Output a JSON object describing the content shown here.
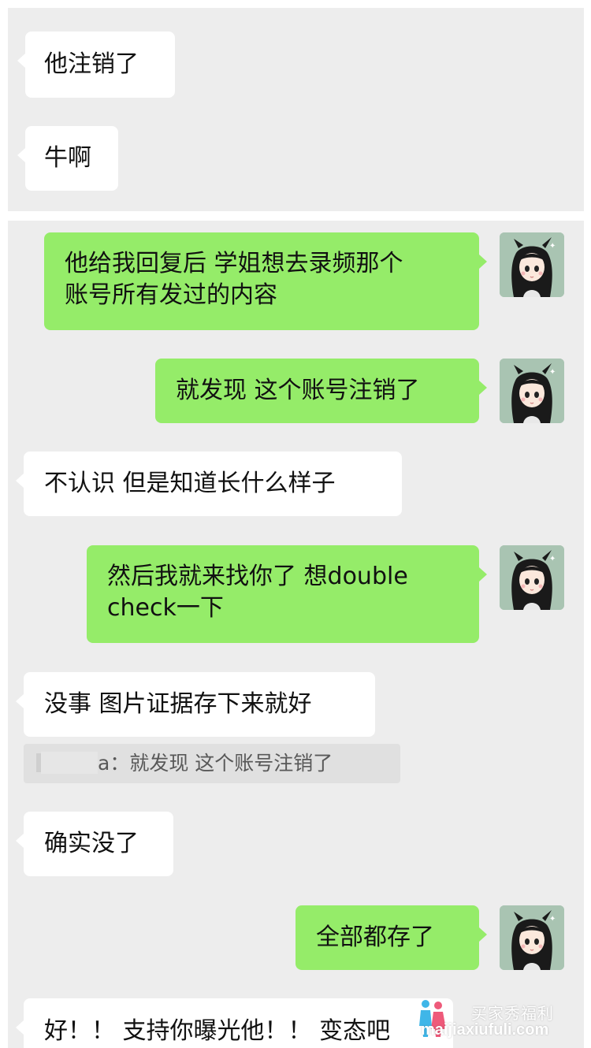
{
  "top_panel": {
    "messages": [
      {
        "sender": "other",
        "text": "他注销了"
      },
      {
        "sender": "other",
        "text": "牛啊"
      }
    ]
  },
  "main_panel": {
    "messages": [
      {
        "sender": "me",
        "lines": [
          "他给我回复后 学姐想去录频那个",
          "账号所有发过的内容"
        ]
      },
      {
        "sender": "me",
        "lines": [
          "就发现 这个账号注销了"
        ]
      },
      {
        "sender": "other",
        "lines": [
          "不认识 但是知道长什么样子"
        ]
      },
      {
        "sender": "me",
        "lines": [
          "然后我就来找你了 想double",
          "check一下"
        ]
      },
      {
        "sender": "other",
        "lines": [
          "没事 图片证据存下来就好"
        ]
      },
      {
        "sender": "other",
        "lines": [
          "确实没了"
        ]
      },
      {
        "sender": "me",
        "lines": [
          "全部都存了"
        ]
      },
      {
        "sender": "other",
        "lines": [
          "好！！ 支持你曝光他！！ 变态吧"
        ]
      }
    ],
    "quote": {
      "name_suffix": "a：",
      "text": "就发现 这个账号注销了"
    }
  },
  "watermark": {
    "title": "买家秀福利",
    "url": "maijiaxiufuli.com"
  },
  "colors": {
    "outgoing_bubble": "#95ec69",
    "incoming_bubble": "#ffffff",
    "chat_background": "#ededed"
  },
  "icons": {
    "avatar": "anime-girl-avatar-icon"
  }
}
